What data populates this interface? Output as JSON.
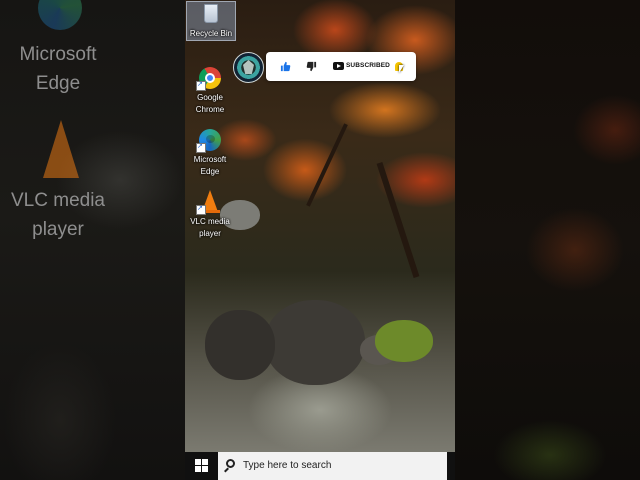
{
  "desktop_icons": [
    {
      "label": "Recycle Bin",
      "icon": "recycle-bin-icon"
    },
    {
      "label": "Google Chrome",
      "icon": "chrome-icon"
    },
    {
      "label": "Microsoft Edge",
      "icon": "edge-icon"
    },
    {
      "label": "VLC media player",
      "icon": "vlc-icon"
    }
  ],
  "ghost_left": {
    "edge_label": "Microsoft Edge",
    "vlc_label": "VLC media player"
  },
  "subscribe_overlay": {
    "subscribe_label": "SUBSCRIBED",
    "like_icon": "thumbs-up-icon",
    "dislike_icon": "thumbs-down-icon",
    "bell_icon": "bell-icon"
  },
  "taskbar": {
    "search_placeholder": "Type here to search",
    "start_icon": "windows-logo-icon"
  },
  "colors": {
    "taskbar": "#101010",
    "search_box": "#f2f2f2",
    "like_blue": "#1a73e8",
    "bell_yellow": "#f5c400"
  }
}
